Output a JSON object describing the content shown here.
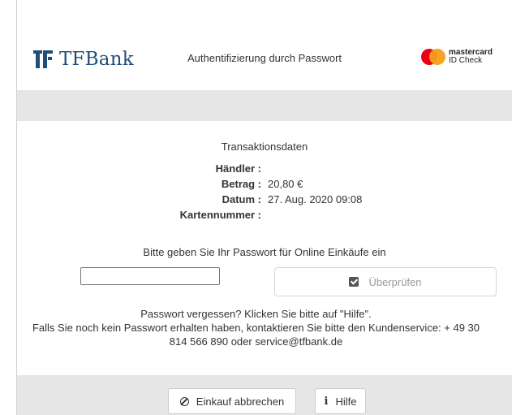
{
  "header": {
    "bank_name": "TFBank",
    "auth_title": "Authentifizierung durch Passwort",
    "mastercard_line1": "mastercard",
    "mastercard_line2": "ID Check",
    "colors": {
      "brand": "#1f4e7a",
      "mc_red": "#eb001b",
      "mc_orange": "#f79e1b"
    }
  },
  "transaction": {
    "title": "Transaktionsdaten",
    "merchant_label": "Händler :",
    "merchant_value": "",
    "amount_label": "Betrag :",
    "amount_value": "20,80 €",
    "date_label": "Datum :",
    "date_value": "27. Aug. 2020 09:08",
    "card_label": "Kartennummer :",
    "card_value": ""
  },
  "auth": {
    "prompt": "Bitte geben Sie Ihr Passwort für Online Einkäufe ein",
    "password_value": "",
    "verify_label": "Überprüfen"
  },
  "help": {
    "line1": "Passwort vergessen? Klicken Sie bitte auf \"Hilfe\".",
    "line2": "Falls Sie noch kein Passwort erhalten haben, kontaktieren Sie bitte den Kundenservice: + 49 30",
    "line3": "814 566 890 oder service@tfbank.de"
  },
  "footer": {
    "cancel_label": "Einkauf abbrechen",
    "help_label": "Hilfe",
    "cancel_icon": "ban-icon",
    "help_icon": "info-icon"
  }
}
